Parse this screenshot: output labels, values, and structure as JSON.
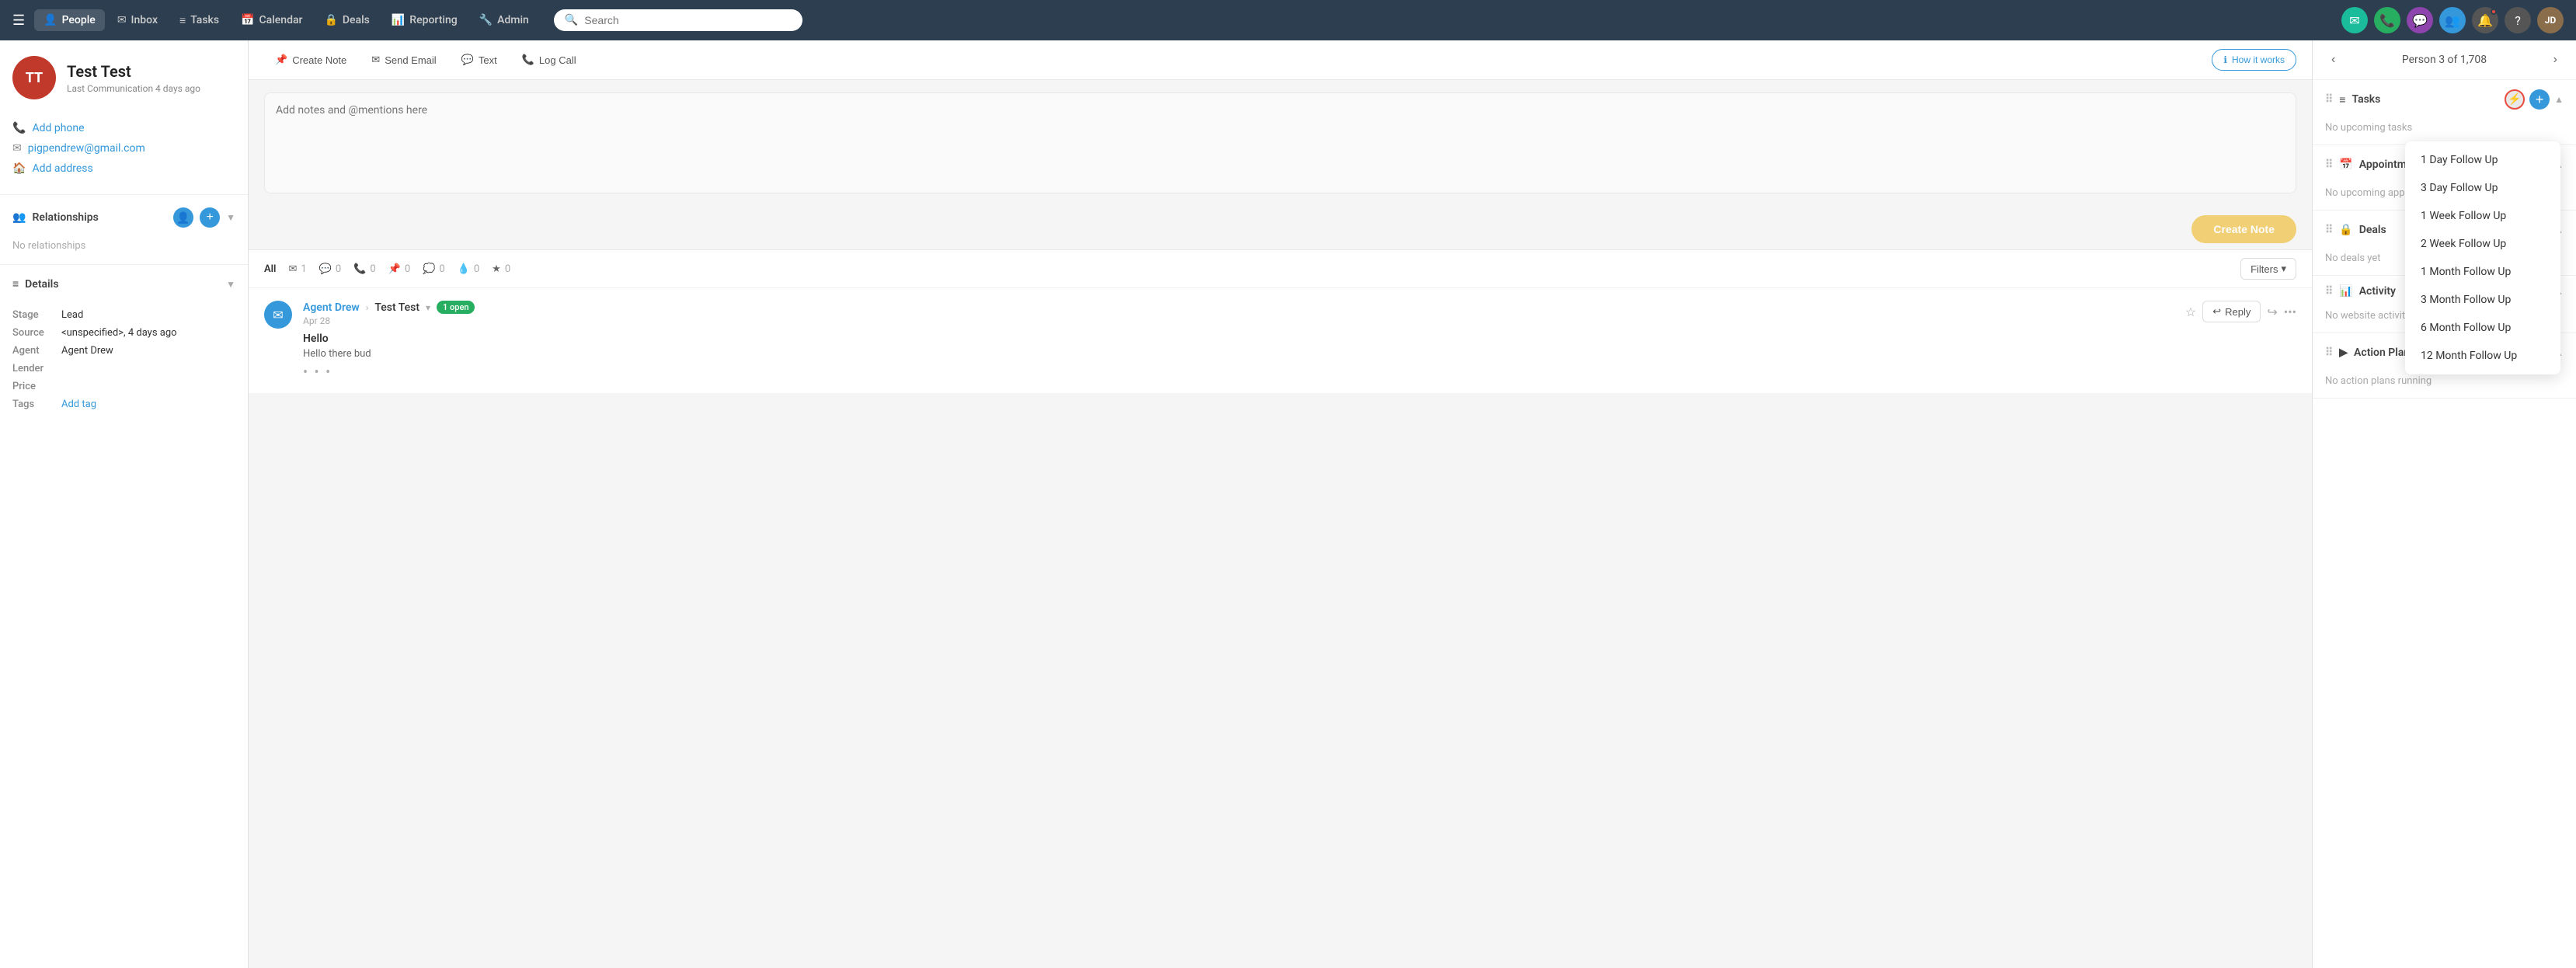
{
  "topnav": {
    "logo_icon": "☰",
    "items": [
      {
        "id": "people",
        "label": "People",
        "icon": "👤",
        "active": true
      },
      {
        "id": "inbox",
        "label": "Inbox",
        "icon": "✉",
        "active": false
      },
      {
        "id": "tasks",
        "label": "Tasks",
        "icon": "≡",
        "active": false
      },
      {
        "id": "calendar",
        "label": "Calendar",
        "icon": "📅",
        "active": false
      },
      {
        "id": "deals",
        "label": "Deals",
        "icon": "🔒",
        "active": false
      },
      {
        "id": "reporting",
        "label": "Reporting",
        "icon": "📊",
        "active": false
      },
      {
        "id": "admin",
        "label": "Admin",
        "icon": "🔧",
        "active": false
      }
    ],
    "search_placeholder": "Search",
    "right_icons": [
      {
        "id": "email",
        "icon": "✉",
        "color": "teal"
      },
      {
        "id": "phone",
        "icon": "📞",
        "color": "green"
      },
      {
        "id": "chat",
        "icon": "💬",
        "color": "purple"
      },
      {
        "id": "contacts",
        "icon": "👥",
        "color": "blue-light"
      },
      {
        "id": "bell",
        "icon": "🔔",
        "color": "grey",
        "notif": true
      },
      {
        "id": "help",
        "icon": "?",
        "color": "grey"
      }
    ],
    "avatar_initials": "JD"
  },
  "left_panel": {
    "contact": {
      "initials": "TT",
      "name": "Test Test",
      "last_comm": "Last Communication 4 days ago"
    },
    "info_items": [
      {
        "id": "phone",
        "icon": "📞",
        "label": "Add phone"
      },
      {
        "id": "email",
        "icon": "✉",
        "label": "pigpendrew@gmail.com"
      },
      {
        "id": "address",
        "icon": "🏠",
        "label": "Add address"
      }
    ],
    "relationships": {
      "title": "Relationships",
      "no_data": "No relationships"
    },
    "details": {
      "title": "Details",
      "fields": [
        {
          "label": "Stage",
          "value": "Lead"
        },
        {
          "label": "Source",
          "value": "<unspecified>, 4 days ago"
        },
        {
          "label": "Agent",
          "value": "Agent Drew"
        },
        {
          "label": "Lender",
          "value": ""
        },
        {
          "label": "Price",
          "value": ""
        },
        {
          "label": "Tags",
          "value": "Add tag",
          "is_link": true
        }
      ]
    }
  },
  "center_panel": {
    "action_bar": [
      {
        "id": "create-note",
        "icon": "📌",
        "label": "Create Note"
      },
      {
        "id": "send-email",
        "icon": "✉",
        "label": "Send Email"
      },
      {
        "id": "text",
        "icon": "💬",
        "label": "Text"
      },
      {
        "id": "log-call",
        "icon": "📞",
        "label": "Log Call"
      }
    ],
    "how_it_works": "How it works",
    "note_placeholder": "Add notes and @mentions here",
    "create_note_btn": "Create Note",
    "feed_filters": [
      {
        "id": "all",
        "label": "All",
        "count": null,
        "active": true
      },
      {
        "id": "email",
        "label": "",
        "icon": "✉",
        "count": "1",
        "active": false
      },
      {
        "id": "text",
        "label": "",
        "icon": "💬",
        "count": "0",
        "active": false
      },
      {
        "id": "call",
        "label": "",
        "icon": "📞",
        "count": "0",
        "active": false
      },
      {
        "id": "pin",
        "label": "",
        "icon": "📌",
        "count": "0",
        "active": false
      },
      {
        "id": "msg",
        "label": "",
        "icon": "💭",
        "count": "0",
        "active": false
      },
      {
        "id": "drop",
        "label": "",
        "icon": "💧",
        "count": "0",
        "active": false
      },
      {
        "id": "star",
        "label": "",
        "icon": "★",
        "count": "0",
        "active": false
      }
    ],
    "filters_btn": "Filters",
    "feed_items": [
      {
        "id": "item1",
        "icon": "✉",
        "icon_color": "#3498db",
        "agent": "Agent Drew",
        "contact": "Test Test",
        "date": "Apr 28",
        "badge": "1 open",
        "badge_color": "#27ae60",
        "subject": "Hello",
        "body": "Hello there bud",
        "has_more": true
      }
    ]
  },
  "right_panel": {
    "nav": {
      "prev_label": "‹",
      "next_label": "›",
      "title": "Person 3 of 1,708"
    },
    "sections": [
      {
        "id": "tasks",
        "title": "Tasks",
        "icon": "≡",
        "no_data": "No upcoming tasks",
        "show_dropdown": true
      },
      {
        "id": "appointments",
        "title": "Appointments",
        "icon": "📅",
        "no_data": "No upcoming appointments"
      },
      {
        "id": "deals",
        "title": "Deals",
        "icon": "🔒",
        "no_data": "No deals yet"
      },
      {
        "id": "activity",
        "title": "Activity",
        "icon": "📊",
        "no_data": "No website activity yet"
      },
      {
        "id": "action-plans",
        "title": "Action Plans",
        "icon": "▶",
        "no_data": "No action plans running"
      }
    ],
    "task_dropdown": {
      "items": [
        "1 Day Follow Up",
        "3 Day Follow Up",
        "1 Week Follow Up",
        "2 Week Follow Up",
        "1 Month Follow Up",
        "3 Month Follow Up",
        "6 Month Follow Up",
        "12 Month Follow Up"
      ]
    }
  }
}
